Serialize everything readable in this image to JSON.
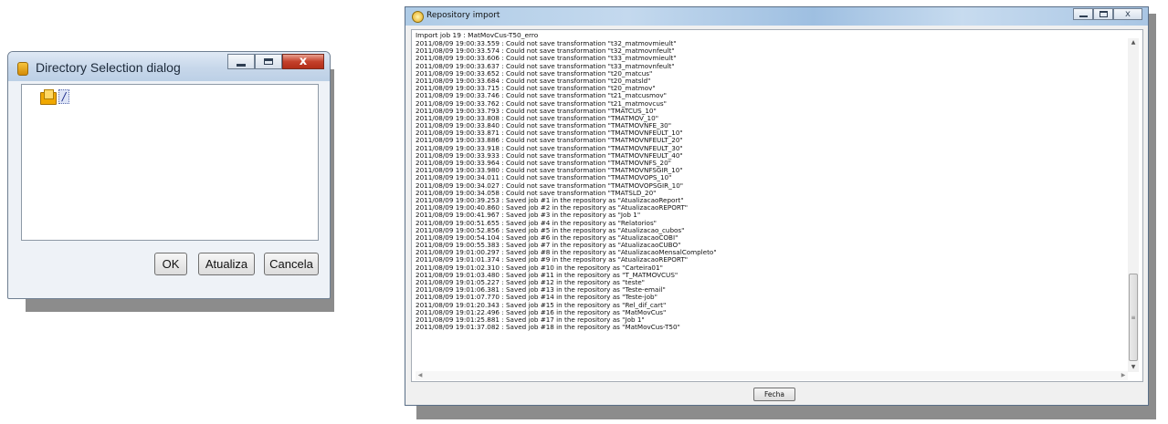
{
  "directory_dialog": {
    "title": "Directory Selection dialog",
    "root_label": "/",
    "buttons": {
      "ok": "OK",
      "refresh": "Atualiza",
      "cancel": "Cancela"
    },
    "window_controls": {
      "close": "x"
    }
  },
  "repository_dialog": {
    "title": "Repository import",
    "header": "Import job 19 : MatMovCus-T50_erro",
    "window_controls": {
      "close": "x"
    },
    "log": [
      "2011/08/09 19:00:33.559 : Could not save transformation \"t32_matmovmieult\"",
      "2011/08/09 19:00:33.574 : Could not save transformation \"t32_matmovnfeult\"",
      "2011/08/09 19:00:33.606 : Could not save transformation \"t33_matmovmieult\"",
      "2011/08/09 19:00:33.637 : Could not save transformation \"t33_matmovnfeult\"",
      "2011/08/09 19:00:33.652 : Could not save transformation \"t20_matcus\"",
      "2011/08/09 19:00:33.684 : Could not save transformation \"t20_matsld\"",
      "2011/08/09 19:00:33.715 : Could not save transformation \"t20_matmov\"",
      "2011/08/09 19:00:33.746 : Could not save transformation \"t21_matcusmov\"",
      "2011/08/09 19:00:33.762 : Could not save transformation \"t21_matmovcus\"",
      "2011/08/09 19:00:33.793 : Could not save transformation \"TMATCUS_10\"",
      "2011/08/09 19:00:33.808 : Could not save transformation \"TMATMOV_10\"",
      "2011/08/09 19:00:33.840 : Could not save transformation \"TMATMOVNFE_30\"",
      "2011/08/09 19:00:33.871 : Could not save transformation \"TMATMOVNFEULT_10\"",
      "2011/08/09 19:00:33.886 : Could not save transformation \"TMATMOVNFEULT_20\"",
      "2011/08/09 19:00:33.918 : Could not save transformation \"TMATMOVNFEULT_30\"",
      "2011/08/09 19:00:33.933 : Could not save transformation \"TMATMOVNFEULT_40\"",
      "2011/08/09 19:00:33.964 : Could not save transformation \"TMATMOVNFS_20\"",
      "2011/08/09 19:00:33.980 : Could not save transformation \"TMATMOVNFSGIR_10\"",
      "2011/08/09 19:00:34.011 : Could not save transformation \"TMATMOVOPS_10\"",
      "2011/08/09 19:00:34.027 : Could not save transformation \"TMATMOVOPSGIR_10\"",
      "2011/08/09 19:00:34.058 : Could not save transformation \"TMATSLD_20\"",
      "2011/08/09 19:00:39.253 : Saved job #1 in the repository as \"AtualizacaoReport\"",
      "2011/08/09 19:00:40.860 : Saved job #2 in the repository as \"AtualizacaoREPORT\"",
      "2011/08/09 19:00:41.967 : Saved job #3 in the repository as \"Job 1\"",
      "2011/08/09 19:00:51.655 : Saved job #4 in the repository as \"Relatorios\"",
      "2011/08/09 19:00:52.856 : Saved job #5 in the repository as \"Atualizacao_cubos\"",
      "2011/08/09 19:00:54.104 : Saved job #6 in the repository as \"AtualizacaoCOBI\"",
      "2011/08/09 19:00:55.383 : Saved job #7 in the repository as \"AtualizacaoCUBO\"",
      "2011/08/09 19:01:00.297 : Saved job #8 in the repository as \"AtualizacaoMensalCompleto\"",
      "2011/08/09 19:01:01.374 : Saved job #9 in the repository as \"AtualizacaoREPORT\"",
      "2011/08/09 19:01:02.310 : Saved job #10 in the repository as \"Carteira01\"",
      "2011/08/09 19:01:03.480 : Saved job #11 in the repository as \"T_MATMOVCUS\"",
      "2011/08/09 19:01:05.227 : Saved job #12 in the repository as \"teste\"",
      "2011/08/09 19:01:06.381 : Saved job #13 in the repository as \"Teste-email\"",
      "2011/08/09 19:01:07.770 : Saved job #14 in the repository as \"Teste-job\"",
      "2011/08/09 19:01:20.343 : Saved job #15 in the repository as \"Rel_dif_cart\"",
      "2011/08/09 19:01:22.496 : Saved job #16 in the repository as \"MatMovCus\"",
      "2011/08/09 19:01:25.881 : Saved job #17 in the repository as \"Job 1\"",
      "2011/08/09 19:01:37.082 : Saved job #18 in the repository as \"MatMovCus-T50\""
    ],
    "close_button": "Fecha"
  }
}
